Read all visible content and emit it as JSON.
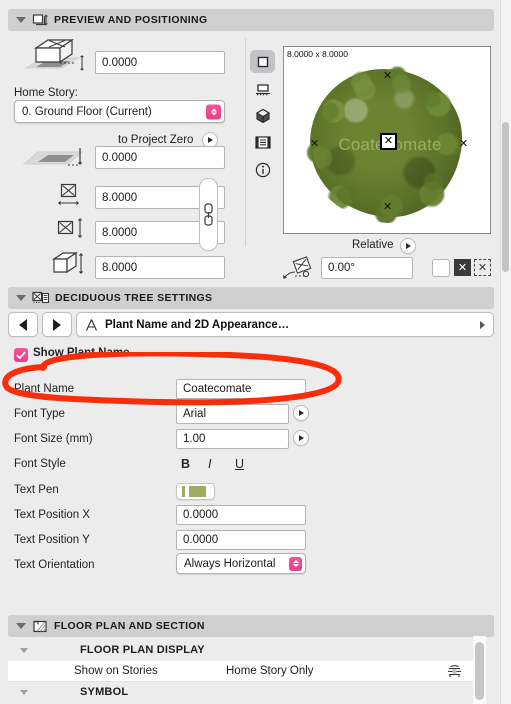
{
  "sections": {
    "preview": {
      "title": "PREVIEW AND POSITIONING",
      "icon": "preview-positioning-icon"
    },
    "tree": {
      "title": "DECIDUOUS TREE SETTINGS",
      "icon": "tree-settings-icon"
    },
    "floorplan": {
      "title": "FLOOR PLAN AND SECTION",
      "icon": "floor-plan-section-icon"
    }
  },
  "positioning": {
    "elevation_to_home_story": "0.0000",
    "home_story_label": "Home Story:",
    "home_story_value": "0. Ground Floor (Current)",
    "to_project_zero_label": "to Project Zero",
    "elevation_to_project_zero": "0.0000",
    "width": "8.0000",
    "depth": "8.0000",
    "height": "8.0000",
    "link_dimensions_icon": "chain-link-icon",
    "icons": {
      "elevation_home_story": "box-on-story-icon",
      "elevation_project_zero": "project-zero-plane-icon",
      "width": "width-dimension-icon",
      "depth": "depth-dimension-icon",
      "height": "height-dimension-icon"
    }
  },
  "preview_panel": {
    "size_label": "8.0000 x 8.0000",
    "plant_label_in_preview": "Coatecomate",
    "plant_label_color": "#9fae63",
    "relative_label": "Relative",
    "angle_value": "0.00°",
    "rail": [
      {
        "name": "2d-symbol-view-icon",
        "selected": true
      },
      {
        "name": "elevation-view-icon",
        "selected": false
      },
      {
        "name": "3d-view-icon",
        "selected": false
      },
      {
        "name": "preview-list-icon",
        "selected": false
      },
      {
        "name": "info-icon",
        "selected": false
      }
    ],
    "mirror_checkbox_checked": false,
    "anchor_icon": "anchor-node-icon",
    "anchor_alt_icon": "anchor-node-dashed-icon",
    "rotate_icon": "rotate-object-icon"
  },
  "tree_settings": {
    "nav_prev_icon": "nav-previous-icon",
    "nav_next_icon": "nav-next-icon",
    "page_icon": "text-a-icon",
    "page_label": "Plant Name and 2D Appearance…",
    "show_plant_name_label": "Show Plant Name",
    "show_plant_name_checked": true,
    "accent_color": "#ee3f8c",
    "fields": [
      {
        "label": "Plant Name",
        "value": "Coatecomate"
      },
      {
        "label": "Font Type",
        "value": "Arial"
      },
      {
        "label": "Font Size (mm)",
        "value": "1.00"
      },
      {
        "label": "Font Style",
        "value": ""
      },
      {
        "label": "Text Pen",
        "value": ""
      },
      {
        "label": "Text Position X",
        "value": "0.0000"
      },
      {
        "label": "Text Position Y",
        "value": "0.0000"
      },
      {
        "label": "Text Orientation",
        "value": "Always Horizontal"
      }
    ],
    "font_style_buttons": [
      {
        "name": "bold-button",
        "glyph": "B"
      },
      {
        "name": "italic-button",
        "glyph": "I"
      },
      {
        "name": "underline-button",
        "glyph": "U"
      }
    ],
    "text_pen_color": "#9dae61"
  },
  "floor_plan": {
    "subsections": [
      {
        "label": "FLOOR PLAN DISPLAY"
      },
      {
        "label": "SYMBOL"
      }
    ],
    "rows": [
      {
        "label": "Show on Stories",
        "value": "Home Story Only",
        "icon": "show-on-stories-icon"
      }
    ]
  },
  "annotation": {
    "shape": "red-ellipse-highlight",
    "color": "#f92d0a"
  }
}
